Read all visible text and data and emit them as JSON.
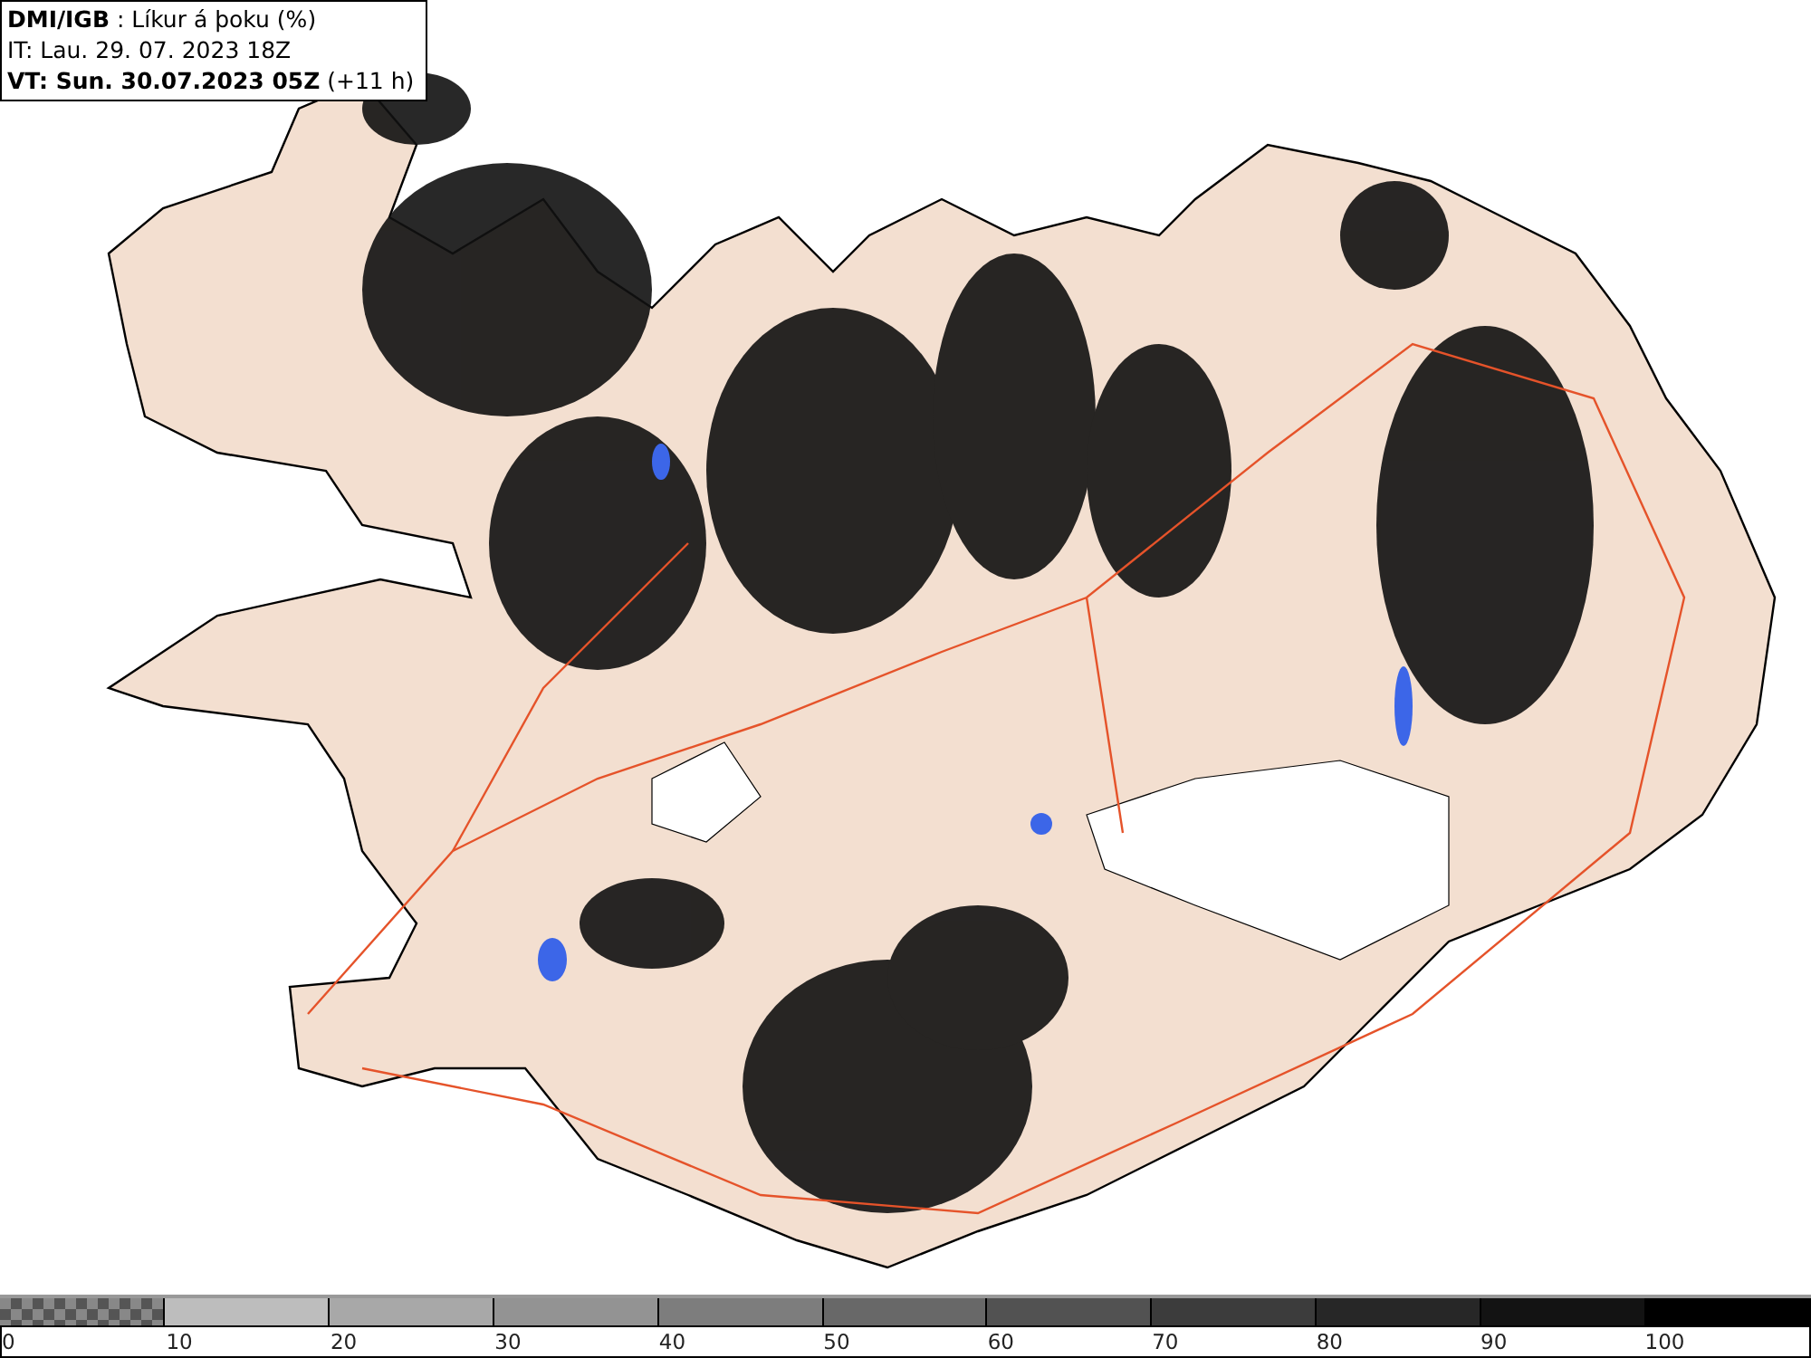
{
  "header": {
    "lines": [
      "**DMI/IGB** : Líkur á þoku (%)",
      "IT: Lau. 29. 07. 2023 18Z",
      "**VT: Sun. 30.07.2023 05Z** (+11 h)"
    ]
  },
  "legend": {
    "segments": [
      {
        "kind": "checker",
        "color": "#888888"
      },
      {
        "kind": "solid",
        "color": "#bdbdbd"
      },
      {
        "kind": "solid",
        "color": "#a8a8a8"
      },
      {
        "kind": "solid",
        "color": "#939393"
      },
      {
        "kind": "solid",
        "color": "#7d7d7d"
      },
      {
        "kind": "solid",
        "color": "#686868"
      },
      {
        "kind": "solid",
        "color": "#525252"
      },
      {
        "kind": "solid",
        "color": "#3c3c3c"
      },
      {
        "kind": "solid",
        "color": "#272727"
      },
      {
        "kind": "solid",
        "color": "#131313"
      },
      {
        "kind": "solid",
        "color": "#000000"
      }
    ],
    "ticks": [
      "0",
      "10",
      "20",
      "30",
      "40",
      "50",
      "60",
      "70",
      "80",
      "90",
      "100"
    ]
  }
}
